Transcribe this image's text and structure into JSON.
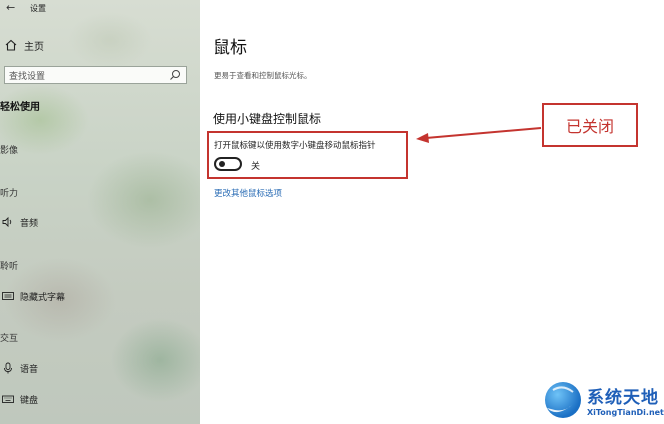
{
  "window": {
    "title": "设置"
  },
  "sidebar": {
    "home_label": "主页",
    "search": {
      "placeholder": "查找设置"
    },
    "section_header": "轻松使用",
    "groups": {
      "vision": "影像",
      "hearing": "听力",
      "interaction": "交互"
    },
    "groups_extra": {
      "hearing_sub": "聆听"
    },
    "items": {
      "audio": "音频",
      "captions": "隐藏式字幕",
      "speech": "语音",
      "keyboard": "键盘"
    }
  },
  "main": {
    "title": "鼠标",
    "description": "更易于查看和控制鼠标光标。",
    "section_heading": "使用小键盘控制鼠标",
    "toggle_label": "打开鼠标键以使用数字小键盘移动鼠标指针",
    "toggle_state": "关",
    "toggle_on": false,
    "more_link": "更改其他鼠标选项"
  },
  "annotation": {
    "callout_text": "已关闭",
    "color": "#c4342f"
  },
  "watermark": {
    "name_cn": "系统天地",
    "name_en": "XiTongTianDi.net"
  },
  "colors": {
    "link": "#2a6cb5",
    "annotation_red": "#c4342f",
    "logo_blue": "#1f5fb8"
  }
}
